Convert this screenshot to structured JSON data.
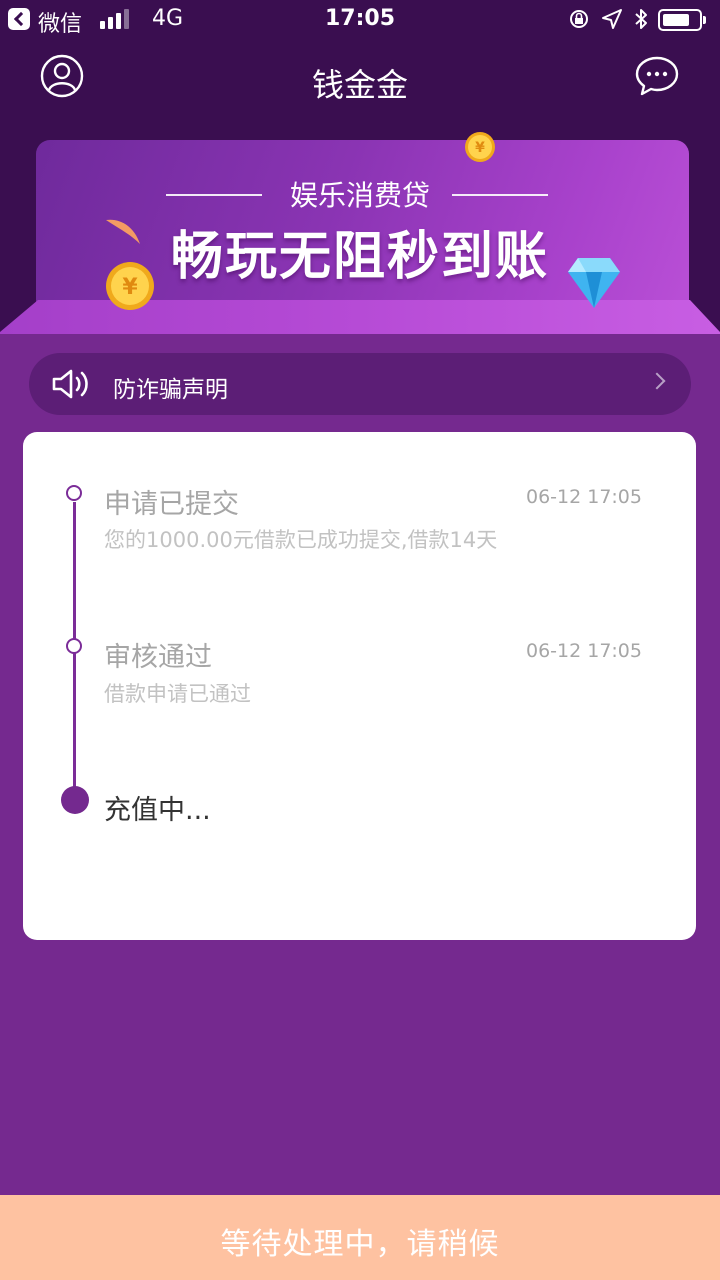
{
  "status_bar": {
    "app": "微信",
    "network": "4G",
    "time": "17:05"
  },
  "nav": {
    "title": "钱金金",
    "icons": {
      "left": "user-icon",
      "right": "chat-bubble-icon"
    }
  },
  "banner": {
    "subtitle": "娱乐消费贷",
    "title": "畅玩无阻秒到账",
    "coin_symbol": "¥"
  },
  "fraud_notice": {
    "label": "防诈骗声明",
    "icon": "speaker-icon"
  },
  "timeline": {
    "steps": [
      {
        "title": "申请已提交",
        "time": "06-12 17:05",
        "desc": "您的1000.00元借款已成功提交,借款14天",
        "state": "done"
      },
      {
        "title": "审核通过",
        "time": "06-12 17:05",
        "desc": "借款申请已通过",
        "state": "done"
      },
      {
        "title": "充值中...",
        "state": "active"
      }
    ],
    "accent_color": "#74298F"
  },
  "bottom_button": {
    "label": "等待处理中，请稍候"
  },
  "colors": {
    "header_bg": "#3A0E50",
    "page_bg": "#75298F",
    "bottom_button_bg": "#FEC2A1"
  }
}
